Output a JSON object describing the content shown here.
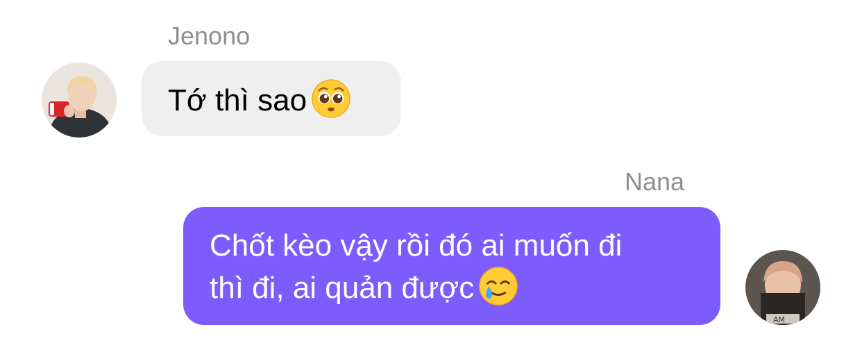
{
  "messages": [
    {
      "sender": "Jenono",
      "text": "Tớ thì sao",
      "emoji": "pleading-face-icon",
      "direction": "incoming"
    },
    {
      "sender": "Nana",
      "line1": "Chốt kèo vậy rồi đó ai muốn đi",
      "line2": "thì đi, ai quản được",
      "emoji": "smiling-face-with-tear-icon",
      "direction": "outgoing"
    }
  ],
  "colors": {
    "incoming_bubble": "#efefef",
    "outgoing_bubble": "#7c5cfc",
    "sender_name": "#8e8e93"
  }
}
